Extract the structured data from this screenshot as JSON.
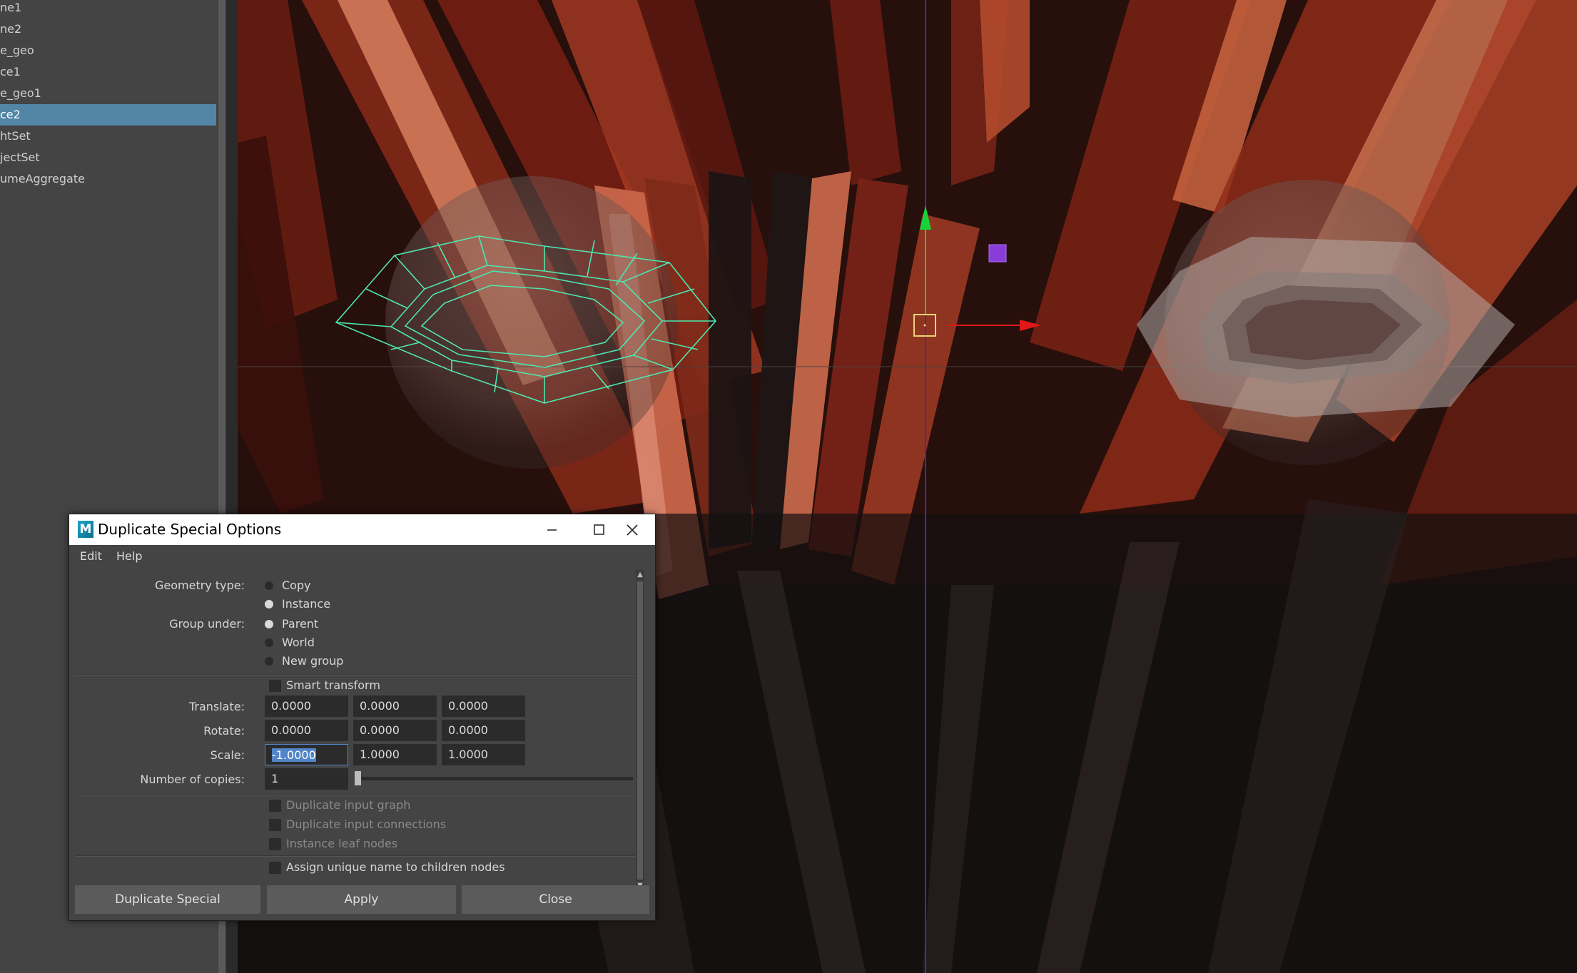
{
  "outliner": {
    "items": [
      {
        "label": "ne1"
      },
      {
        "label": "ne2"
      },
      {
        "label": "e_geo"
      },
      {
        "label": "ce1"
      },
      {
        "label": "e_geo1"
      },
      {
        "label": "ce2",
        "selected": true
      },
      {
        "label": "htSet"
      },
      {
        "label": "jectSet"
      },
      {
        "label": "umeAggregate"
      }
    ]
  },
  "dialog": {
    "app_icon": "M",
    "title": "Duplicate Special Options",
    "window_controls": [
      "minimize-icon",
      "maximize-icon",
      "close-icon"
    ],
    "menu": [
      "Edit",
      "Help"
    ],
    "geometry_type": {
      "label": "Geometry type:",
      "options": [
        "Copy",
        "Instance"
      ],
      "selected": "Instance"
    },
    "group_under": {
      "label": "Group under:",
      "options": [
        "Parent",
        "World",
        "New group"
      ],
      "selected": "Parent"
    },
    "smart_transform": {
      "label": "Smart transform",
      "checked": false
    },
    "translate": {
      "label": "Translate:",
      "values": [
        "0.0000",
        "0.0000",
        "0.0000"
      ]
    },
    "rotate": {
      "label": "Rotate:",
      "values": [
        "0.0000",
        "0.0000",
        "0.0000"
      ]
    },
    "scale": {
      "label": "Scale:",
      "values": [
        "-1.0000",
        "1.0000",
        "1.0000"
      ]
    },
    "copies": {
      "label": "Number of copies:",
      "value": "1"
    },
    "duplicate_input_graph": {
      "label": "Duplicate input graph",
      "checked": false,
      "enabled": false
    },
    "duplicate_input_connections": {
      "label": "Duplicate input connections",
      "checked": false,
      "enabled": false
    },
    "instance_leaf_nodes": {
      "label": "Instance leaf nodes",
      "checked": false,
      "enabled": false
    },
    "assign_unique_name": {
      "label": "Assign unique name to children nodes",
      "checked": false,
      "enabled": true
    },
    "buttons": {
      "duplicate_special": "Duplicate Special",
      "apply": "Apply",
      "close": "Close"
    }
  },
  "viewport": {
    "manipulator_colors": {
      "x_axis": "#e01818",
      "y_axis": "#19d23a",
      "center": "#e8d27a",
      "pivot_marker": "#8a3cd8"
    },
    "wireframe_color": "#4ee6b0"
  }
}
